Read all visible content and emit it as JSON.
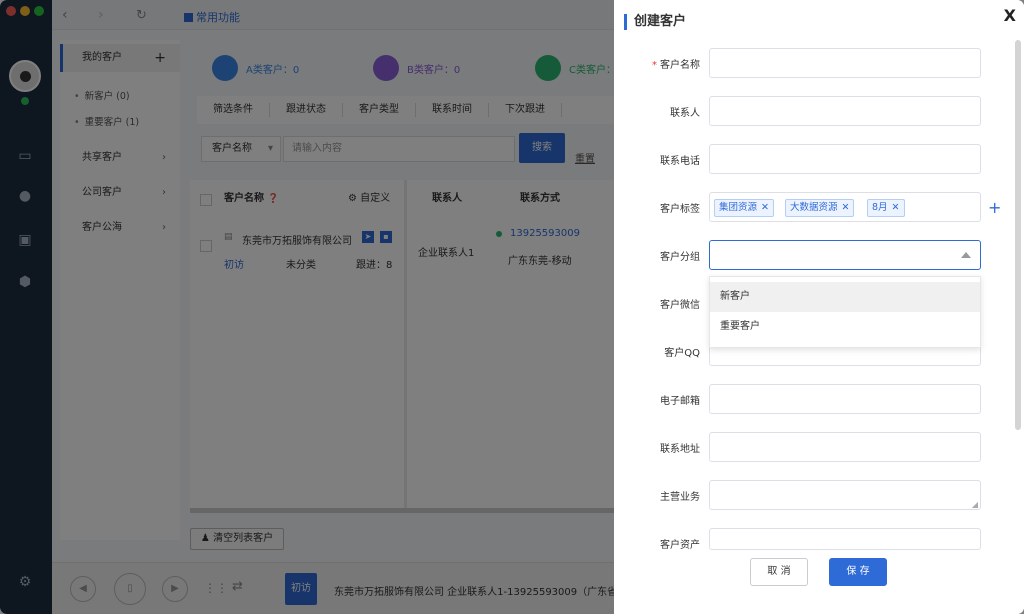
{
  "topbar": {
    "favorites": "常用功能"
  },
  "sidebar": {
    "my_customers": "我的客户",
    "add": "+",
    "sub_items": [
      {
        "label": "新客户 (0)"
      },
      {
        "label": "重要客户 (1)"
      }
    ],
    "shared": "共享客户",
    "company": "公司客户",
    "pool": "客户公海",
    "arrow": "›"
  },
  "categories": [
    {
      "label": "A类客户：0",
      "color": "#3b87e8"
    },
    {
      "label": "B类客户：0",
      "color": "#8b5fd8"
    },
    {
      "label": "C类客户：",
      "color": "#2bb673"
    }
  ],
  "filters": [
    "筛选条件",
    "跟进状态",
    "客户类型",
    "联系时间",
    "下次跟进"
  ],
  "search": {
    "field": "客户名称",
    "placeholder": "请输入内容",
    "button": "搜索",
    "reset": "重置"
  },
  "table": {
    "col_name": "客户名称",
    "customize": "自定义",
    "col_contact": "联系人",
    "col_method": "联系方式",
    "row": {
      "company": "东莞市万拓服饰有限公司",
      "stage": "初访",
      "category": "未分类",
      "follow": "跟进：8",
      "contact": "企业联系人1",
      "phone": "13925593009",
      "region": "广东东莞-移动"
    },
    "clear_button": "清空列表客户"
  },
  "player": {
    "chip": "初访",
    "info": "东莞市万拓服饰有限公司   企业联系人1-13925593009（广东省"
  },
  "drawer": {
    "title": "创建客户",
    "close": "X",
    "labels": {
      "name": "客户名称",
      "contact": "联系人",
      "phone": "联系电话",
      "tags": "客户标签",
      "group": "客户分组",
      "wechat": "客户微信",
      "qq": "客户QQ",
      "email": "电子邮箱",
      "address": "联系地址",
      "business": "主营业务",
      "assets": "客户资产"
    },
    "required_mark": "*",
    "tags": [
      {
        "label": "集团资源"
      },
      {
        "label": "大数据资源"
      },
      {
        "label": "8月"
      }
    ],
    "tag_remove": "✕",
    "add_tag": "+",
    "group_options": [
      {
        "label": "新客户"
      },
      {
        "label": "重要客户"
      }
    ],
    "cancel": "取 消",
    "save": "保 存"
  },
  "colors": {
    "accent": "#2f6bd6",
    "rail": "#1d2c3f"
  }
}
